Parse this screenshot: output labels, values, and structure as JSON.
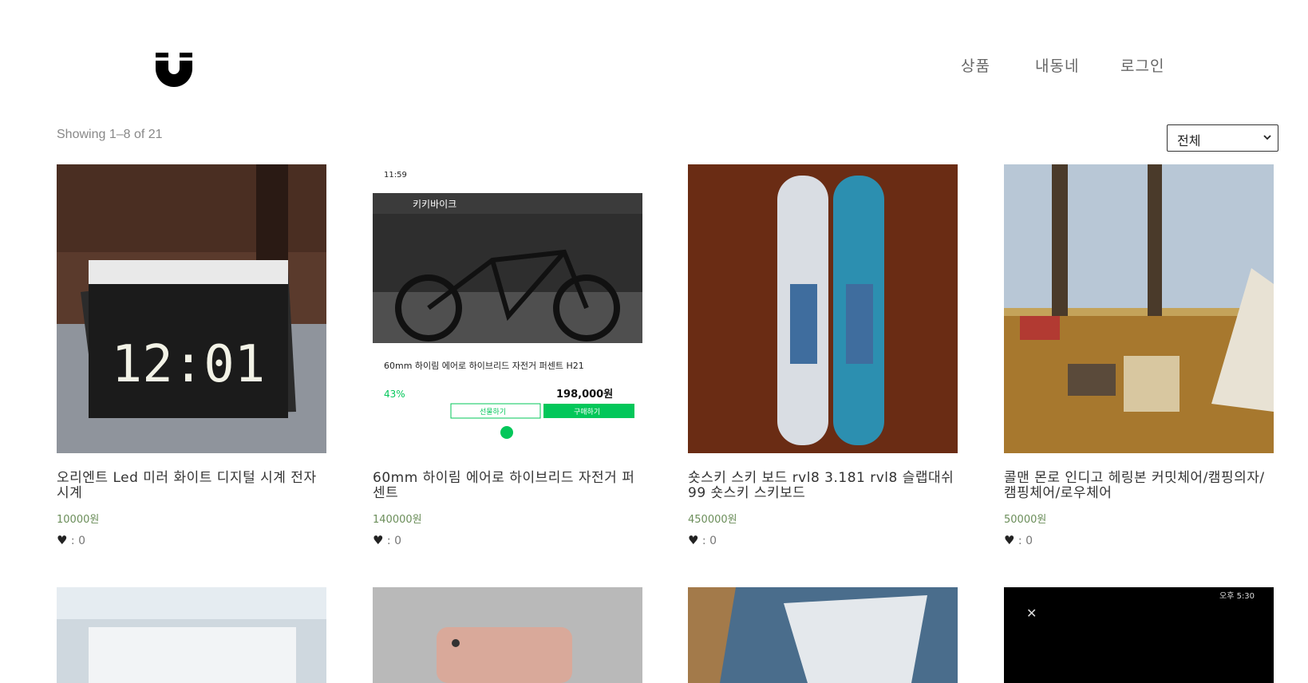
{
  "nav": {
    "items": [
      "상품",
      "내동네",
      "로그인"
    ]
  },
  "listing": {
    "showing": "Showing 1–8 of 21",
    "sort_selected": "전체"
  },
  "products": [
    {
      "title": "오리엔트 Led 미러 화이트 디지털 시계 전자시계",
      "price": "10000원",
      "likes": ": 0",
      "image": "digital-clock-photo"
    },
    {
      "title": "60mm 하이림 에어로 하이브리드 자전거 퍼센트",
      "price": "140000원",
      "likes": ": 0",
      "image": "bicycle-screenshot"
    },
    {
      "title": "숏스키 스키 보드 rvl8 3.181 rvl8 슬랩대쉬99 숏스키 스키보드",
      "price": "450000원",
      "likes": ": 0",
      "image": "ski-boards-photo"
    },
    {
      "title": "콜맨 몬로 인디고 헤링본 커밋체어/캠핑의자/캠핑체어/로우체어",
      "price": "50000원",
      "likes": ": 0",
      "image": "camping-chair-photo"
    }
  ],
  "bike_screenshot": {
    "status_time": "11:59",
    "shop_name": "키키바이크",
    "product_title": "60mm 하이림 에어로 하이브리드 자전거 퍼센트 H21",
    "discount": "43%",
    "price": "198,000원",
    "gift_button": "선물하기",
    "buy_button": "구매하기"
  },
  "clock_display": "12:01",
  "phone_status": "오후 5:30",
  "colors": {
    "price": "#6b8e5a",
    "accent_green": "#03c75a"
  }
}
